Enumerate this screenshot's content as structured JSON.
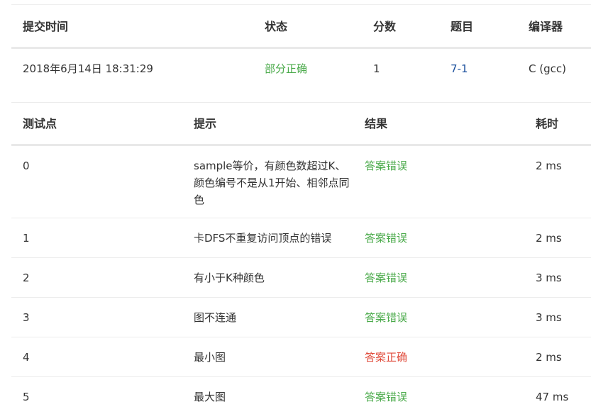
{
  "submission_table": {
    "headers": {
      "time": "提交时间",
      "status": "状态",
      "score": "分数",
      "problem": "题目",
      "compiler": "编译器"
    },
    "row": {
      "time": "2018年6月14日 18:31:29",
      "status": "部分正确",
      "score": "1",
      "problem": "7-1",
      "compiler": "C (gcc)"
    }
  },
  "testcase_table": {
    "headers": {
      "index": "测试点",
      "hint": "提示",
      "result": "结果",
      "time": "耗时"
    },
    "rows": [
      {
        "index": "0",
        "hint": "sample等价，有颜色数超过K、颜色编号不是从1开始、相邻点同色",
        "result": "答案错误",
        "time": "2 ms",
        "result_status": "green"
      },
      {
        "index": "1",
        "hint": "卡DFS不重复访问顶点的错误",
        "result": "答案错误",
        "time": "2 ms",
        "result_status": "green"
      },
      {
        "index": "2",
        "hint": "有小于K种颜色",
        "result": "答案错误",
        "time": "3 ms",
        "result_status": "green"
      },
      {
        "index": "3",
        "hint": "图不连通",
        "result": "答案错误",
        "time": "3 ms",
        "result_status": "green"
      },
      {
        "index": "4",
        "hint": "最小图",
        "result": "答案正确",
        "time": "2 ms",
        "result_status": "red"
      },
      {
        "index": "5",
        "hint": "最大图",
        "result": "答案错误",
        "time": "47 ms",
        "result_status": "green"
      }
    ]
  },
  "colors": {
    "green": "#4aaa4a",
    "red": "#e04a3a",
    "link": "#1a4f9c"
  }
}
